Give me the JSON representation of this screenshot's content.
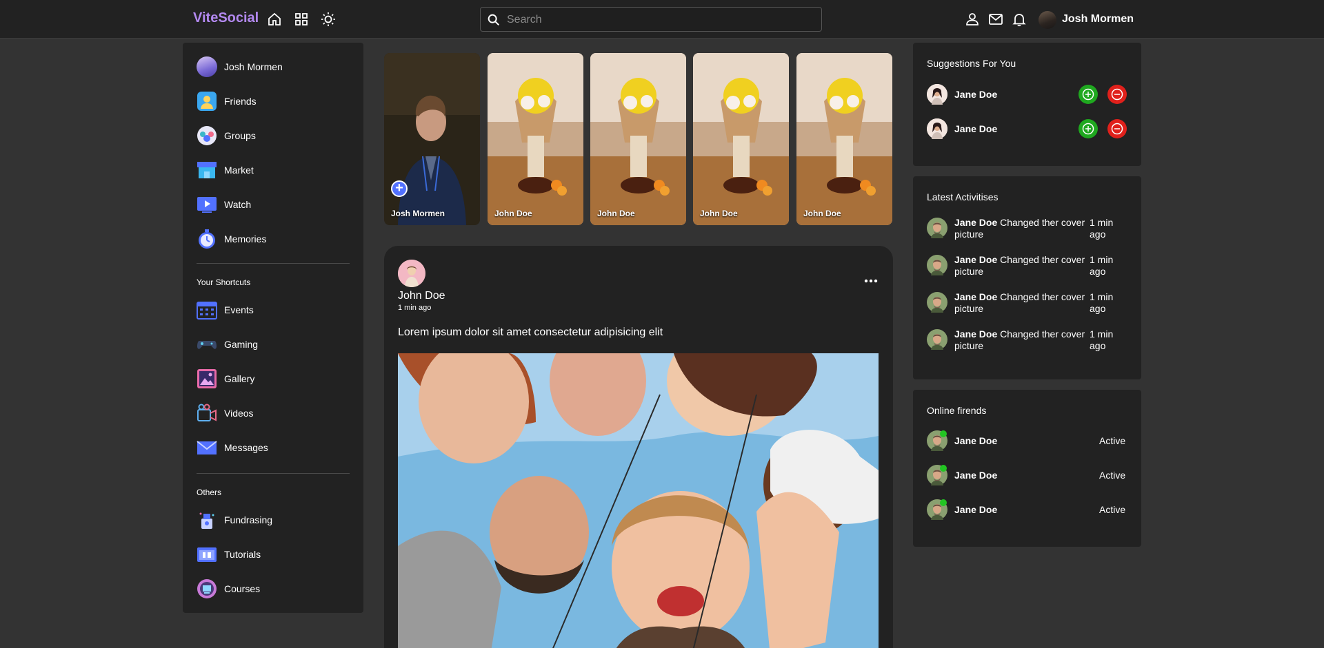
{
  "navbar": {
    "logo": "ViteSocial",
    "icons": [
      "home-icon",
      "grid-icon",
      "sun-icon",
      "person-icon",
      "mail-icon",
      "bell-icon"
    ],
    "search_placeholder": "Search",
    "user_name": "Josh Mormen"
  },
  "leftbar": {
    "main_items": [
      {
        "label": "Josh Mormen",
        "icon": "avatar"
      },
      {
        "label": "Friends",
        "icon": "friends-icon"
      },
      {
        "label": "Groups",
        "icon": "groups-icon"
      },
      {
        "label": "Market",
        "icon": "market-icon"
      },
      {
        "label": "Watch",
        "icon": "watch-icon"
      },
      {
        "label": "Memories",
        "icon": "memories-icon"
      }
    ],
    "shortcuts_title": "Your Shortcuts",
    "shortcut_items": [
      {
        "label": "Events",
        "icon": "events-icon"
      },
      {
        "label": "Gaming",
        "icon": "gaming-icon"
      },
      {
        "label": "Gallery",
        "icon": "gallery-icon"
      },
      {
        "label": "Videos",
        "icon": "videos-icon"
      },
      {
        "label": "Messages",
        "icon": "messages-icon"
      }
    ],
    "others_title": "Others",
    "other_items": [
      {
        "label": "Fundrasing",
        "icon": "fundraising-icon"
      },
      {
        "label": "Tutorials",
        "icon": "tutorials-icon"
      },
      {
        "label": "Courses",
        "icon": "courses-icon"
      }
    ]
  },
  "stories": [
    {
      "name": "Josh Mormen"
    },
    {
      "name": "John Doe"
    },
    {
      "name": "John Doe"
    },
    {
      "name": "John Doe"
    },
    {
      "name": "John Doe"
    }
  ],
  "post": {
    "author": "John Doe",
    "time": "1 min ago",
    "text": "Lorem ipsum dolor sit amet consectetur adipisicing elit"
  },
  "suggestions": {
    "title": "Suggestions For You",
    "users": [
      {
        "name": "Jane Doe"
      },
      {
        "name": "Jane Doe"
      }
    ]
  },
  "activities": {
    "title": "Latest Activitises",
    "items": [
      {
        "name": "Jane Doe",
        "text": "Changed ther cover picture",
        "time": "1 min ago"
      },
      {
        "name": "Jane Doe",
        "text": "Changed ther cover picture",
        "time": "1 min ago"
      },
      {
        "name": "Jane Doe",
        "text": "Changed ther cover picture",
        "time": "1 min ago"
      },
      {
        "name": "Jane Doe",
        "text": "Changed ther cover picture",
        "time": "1 min ago"
      }
    ]
  },
  "online": {
    "title": "Online firends",
    "users": [
      {
        "name": "Jane Doe",
        "status": "Active"
      },
      {
        "name": "Jane Doe",
        "status": "Active"
      },
      {
        "name": "Jane Doe",
        "status": "Active"
      }
    ]
  },
  "colors": {
    "background": "#333333",
    "panel": "#222222",
    "logo": "#b389f0",
    "accept": "#1fa81f",
    "reject": "#e0201b",
    "online": "#22c522"
  }
}
